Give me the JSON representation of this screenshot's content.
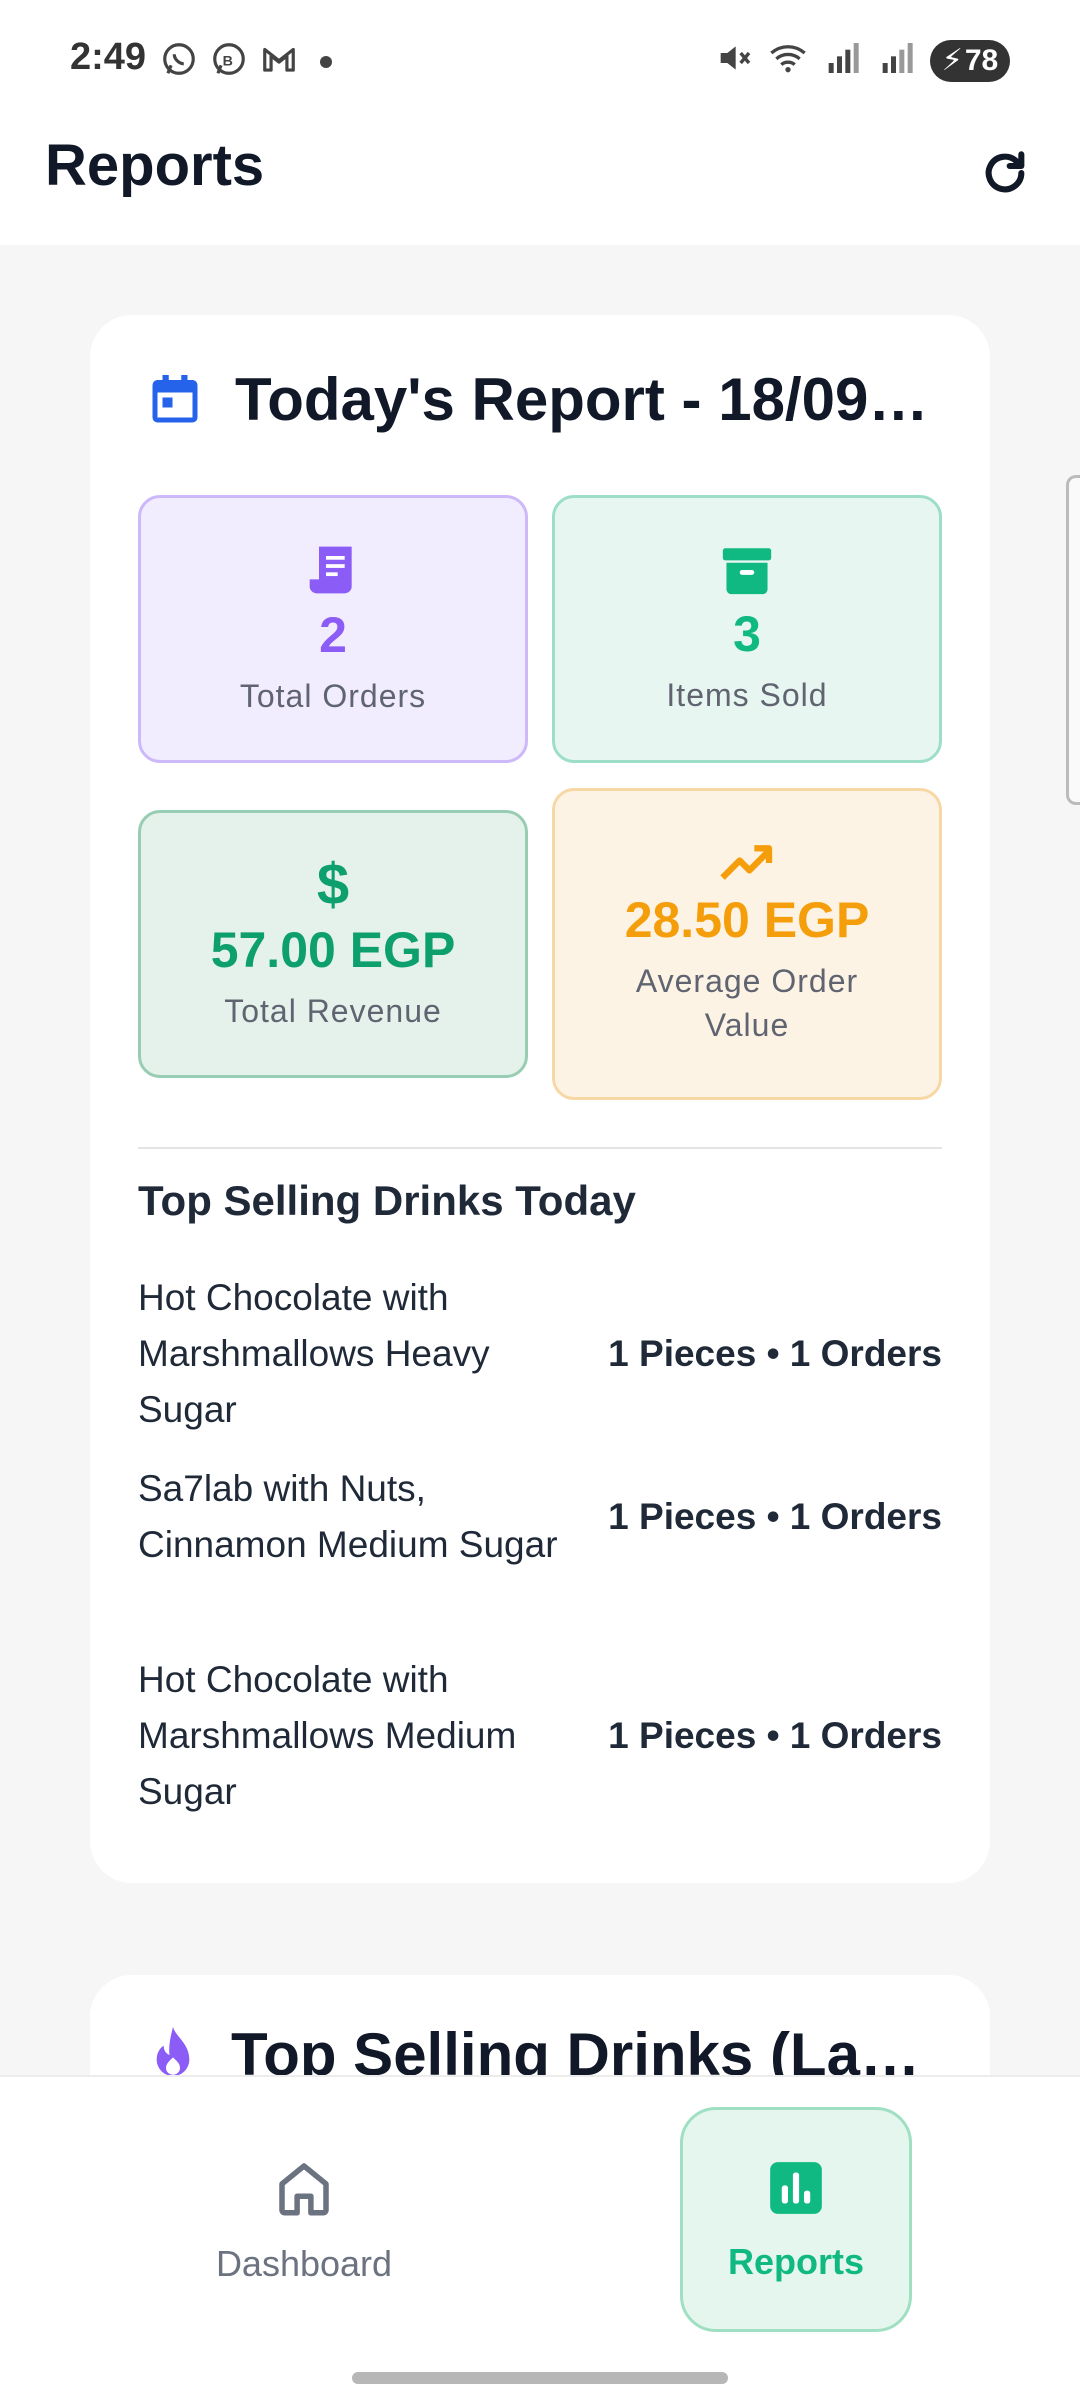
{
  "status_bar": {
    "time": "2:49",
    "battery": "78"
  },
  "app_bar": {
    "title": "Reports"
  },
  "today_report": {
    "title": "Today's Report - 18/09/…",
    "stats": {
      "total_orders": {
        "value": "2",
        "label": "Total Orders"
      },
      "items_sold": {
        "value": "3",
        "label": "Items Sold"
      },
      "total_revenue": {
        "value": "57.00 EGP",
        "label": "Total Revenue"
      },
      "avg_order_value": {
        "value": "28.50 EGP",
        "label": "Average Order Value"
      }
    },
    "top_selling_title": "Top Selling Drinks Today",
    "drinks": [
      {
        "name": "Hot Chocolate with Marshmallows Heavy Sugar",
        "stats": "1 Pieces • 1 Orders"
      },
      {
        "name": "Sa7lab with Nuts, Cinnamon Medium Sugar",
        "stats": "1 Pieces • 1 Orders"
      },
      {
        "name": "Hot Chocolate with Marshmallows Medium Sugar",
        "stats": "1 Pieces • 1 Orders"
      }
    ]
  },
  "next_card": {
    "title": "Top Selling Drinks (Last…"
  },
  "bottom_nav": {
    "dashboard": "Dashboard",
    "reports": "Reports"
  },
  "colors": {
    "purple": "#8b5cf6",
    "green": "#10b981",
    "dark_green": "#0e9f6e",
    "orange": "#f59e0b",
    "blue": "#2563eb"
  }
}
